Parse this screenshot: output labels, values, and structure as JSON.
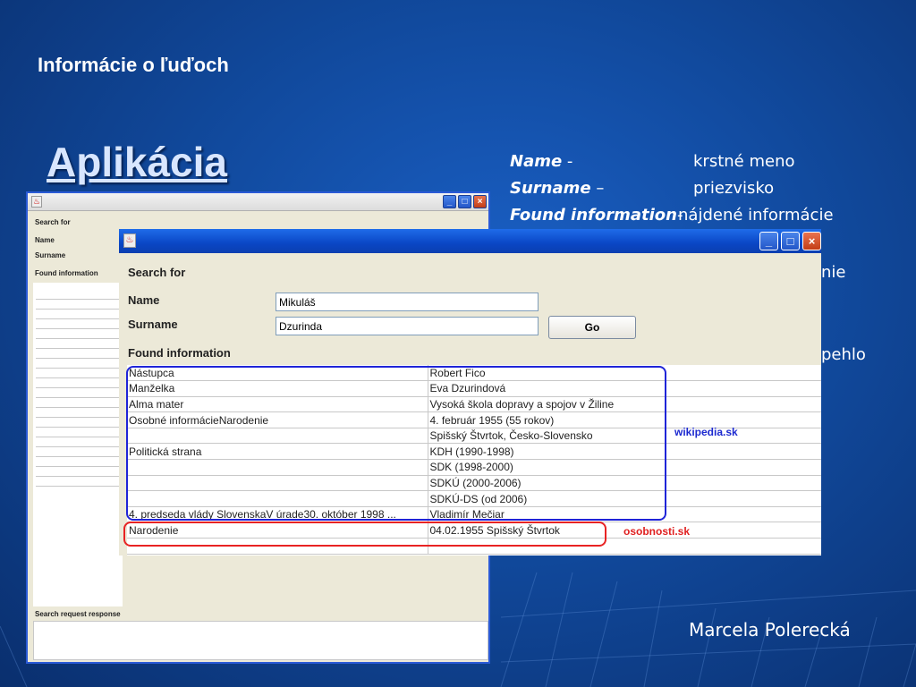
{
  "slide": {
    "header": "Informácie o ľuďoch",
    "title": "Aplikácia",
    "author": "Marcela Polerecká",
    "legend": [
      {
        "term": "Name",
        "sep": " -",
        "desc": "krstné meno"
      },
      {
        "term": "Surname",
        "sep": " –",
        "desc": "priezvisko"
      },
      {
        "term": "Found information",
        "sep": "-",
        "desc": "nájdené informácie"
      }
    ],
    "hidden_fragments": [
      "nie",
      "pehlo"
    ]
  },
  "back_window": {
    "search_for": "Search for",
    "name_label": "Name",
    "surname_label": "Surname",
    "found_label": "Found information",
    "response_label": "Search request response"
  },
  "front_window": {
    "search_for": "Search for",
    "name_label": "Name",
    "surname_label": "Surname",
    "name_value": "Mikuláš",
    "surname_value": "Dzurinda",
    "go_label": "Go",
    "found_label": "Found information",
    "rows": [
      {
        "key": "Nástupca",
        "value": "Robert Fico"
      },
      {
        "key": "Manželka",
        "value": "Eva Dzurindová"
      },
      {
        "key": "Alma mater",
        "value": "Vysoká škola dopravy a spojov v Žiline"
      },
      {
        "key": "Osobné informácieNarodenie",
        "value": "4. február 1955 (55 rokov)"
      },
      {
        "key": "",
        "value": "Spišský Štvrtok, Česko-Slovensko"
      },
      {
        "key": "Politická strana",
        "value": "KDH (1990-1998)"
      },
      {
        "key": "",
        "value": "SDK (1998-2000)"
      },
      {
        "key": "",
        "value": "SDKÚ (2000-2006)"
      },
      {
        "key": "",
        "value": "SDKÚ-DS (od 2006)"
      },
      {
        "key": "4. predseda vlády SlovenskaV úrade30. október 1998 ...",
        "value": "Vladimír Mečiar"
      },
      {
        "key": "Narodenie",
        "value": " 04.02.1955 Spišský Štvrtok"
      },
      {
        "key": "",
        "value": ""
      }
    ],
    "source_wiki": "wikipedia.sk",
    "source_osobnosti": "osobnosti.sk"
  },
  "colors": {
    "background": "#114a9e",
    "highlight_blue": "#1f24d8",
    "highlight_red": "#e82323"
  }
}
